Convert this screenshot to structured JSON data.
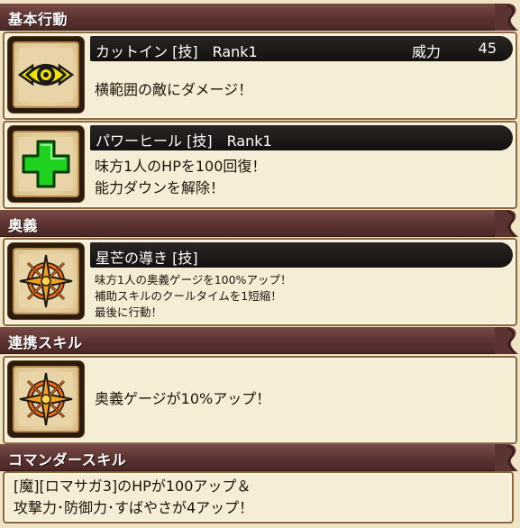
{
  "sections": {
    "basic": "基本行動",
    "ougi": "奥義",
    "renkei": "連携スキル",
    "commander": "コマンダースキル"
  },
  "skills": {
    "cutin": {
      "name": "カットイン [技]　Rank1",
      "power_label": "威力",
      "power_value": "45",
      "desc_line1": "横範囲の敵にダメージ！",
      "icon": "eye-icon"
    },
    "powerheal": {
      "name": "パワーヒール [技]　Rank1",
      "desc_line1": "味方1人のHPを100回復！",
      "desc_line2": "能力ダウンを解除！",
      "icon": "cross-heal-icon"
    },
    "hoshi": {
      "name": "星芒の導き [技]",
      "desc_line1": "味方1人の奥義ゲージを100%アップ！",
      "desc_line2": "補助スキルのクールタイムを1短縮！",
      "desc_line3": "最後に行動！",
      "icon": "compass-star-icon"
    },
    "renkei": {
      "desc_line1": "奥義ゲージが10%アップ！",
      "icon": "compass-star-icon"
    },
    "commander": {
      "desc_line1": "[魔][ロマサガ3]のHPが100アップ＆",
      "desc_line2": "攻撃力･防御力･すばやさが4アップ！"
    }
  },
  "colors": {
    "header": "#5b3331",
    "card_bg": "#f6edd6",
    "name_bar": "#1a1614",
    "heal_green": "#1fd21f",
    "eye_yellow": "#f3e400",
    "star_orange": "#f06a12"
  }
}
